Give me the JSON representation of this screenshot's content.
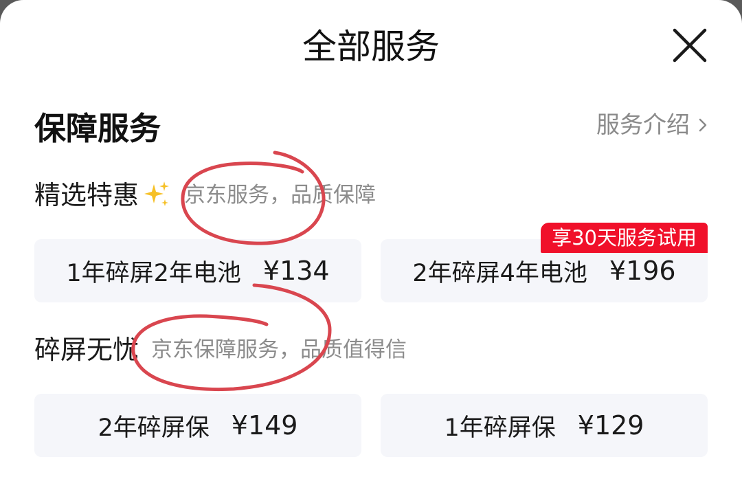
{
  "header": {
    "title": "全部服务"
  },
  "section": {
    "title": "保障服务",
    "intro_label": "服务介绍"
  },
  "groups": [
    {
      "label": "精选特惠",
      "sub": "京东服务，品质保障",
      "cards": [
        {
          "name": "1年碎屏2年电池",
          "price": "¥134"
        },
        {
          "name": "2年碎屏4年电池",
          "price": "¥196",
          "badge": "享30天服务试用"
        }
      ]
    },
    {
      "label": "碎屏无忧",
      "sub": "京东保障服务，品质值得信",
      "cards": [
        {
          "name": "2年碎屏保",
          "price": "¥149"
        },
        {
          "name": "1年碎屏保",
          "price": "¥129"
        }
      ]
    }
  ],
  "colors": {
    "badge": "#f0102a",
    "card_bg": "#f5f6fa",
    "annotation": "#d9464f",
    "muted": "#8c8c8c"
  },
  "icons": {
    "close": "close-icon",
    "chevron": "chevron-right-icon",
    "sparkle": "sparkles-icon"
  }
}
